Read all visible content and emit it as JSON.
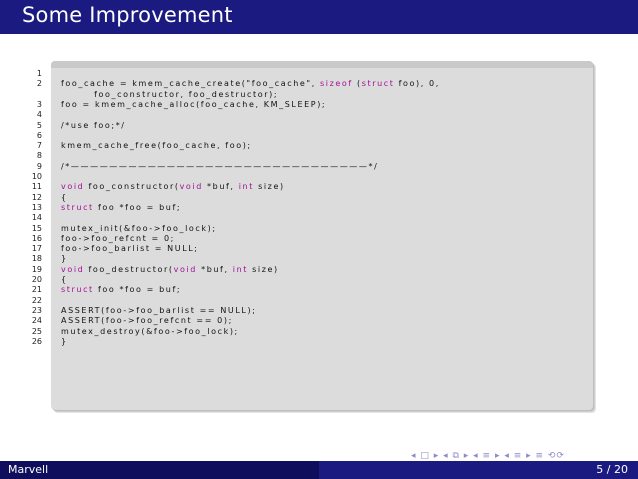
{
  "slide": {
    "title": "Some Improvement",
    "footer_author": "Marvell",
    "footer_page": "5 / 20",
    "nav_symbols": "◂ □ ▸ ◂ ⧉ ▸ ◂ ≡ ▸ ◂ ≡ ▸ ≡ ⟲⟳"
  },
  "code": {
    "lines": [
      {
        "n": "1",
        "text": ""
      },
      {
        "n": "2",
        "text": "foo_cache = kmem_cache_create(\"foo_cache\", sizeof (struct foo), 0,"
      },
      {
        "n": "",
        "text": "        foo_constructor, foo_destructor);"
      },
      {
        "n": "3",
        "text": "foo = kmem_cache_alloc(foo_cache, KM_SLEEP);"
      },
      {
        "n": "4",
        "text": ""
      },
      {
        "n": "5",
        "text": "/*use foo;*/"
      },
      {
        "n": "6",
        "text": ""
      },
      {
        "n": "7",
        "text": "kmem_cache_free(foo_cache, foo);"
      },
      {
        "n": "8",
        "text": ""
      },
      {
        "n": "9",
        "text": "/*———————————————————————————————*/"
      },
      {
        "n": "10",
        "text": ""
      },
      {
        "n": "11",
        "text": "void foo_constructor(void *buf, int size)"
      },
      {
        "n": "12",
        "text": "{"
      },
      {
        "n": "13",
        "text": "struct foo *foo = buf;"
      },
      {
        "n": "14",
        "text": ""
      },
      {
        "n": "15",
        "text": "mutex_init(&foo->foo_lock);"
      },
      {
        "n": "16",
        "text": "foo->foo_refcnt = 0;"
      },
      {
        "n": "17",
        "text": "foo->foo_barlist = NULL;"
      },
      {
        "n": "18",
        "text": "}"
      },
      {
        "n": "19",
        "text": "void foo_destructor(void *buf, int size)"
      },
      {
        "n": "20",
        "text": "{"
      },
      {
        "n": "21",
        "text": "struct foo *foo = buf;"
      },
      {
        "n": "22",
        "text": ""
      },
      {
        "n": "23",
        "text": "ASSERT(foo->foo_barlist == NULL);"
      },
      {
        "n": "24",
        "text": "ASSERT(foo->foo_refcnt == 0);"
      },
      {
        "n": "25",
        "text": "mutex_destroy(&foo->foo_lock);"
      },
      {
        "n": "26",
        "text": "}"
      }
    ]
  },
  "colors": {
    "title_bar": "#1a1a80",
    "footer_dark": "#0e0e5c",
    "keyword": "#a01096",
    "code_background": "#dcdcdc"
  }
}
